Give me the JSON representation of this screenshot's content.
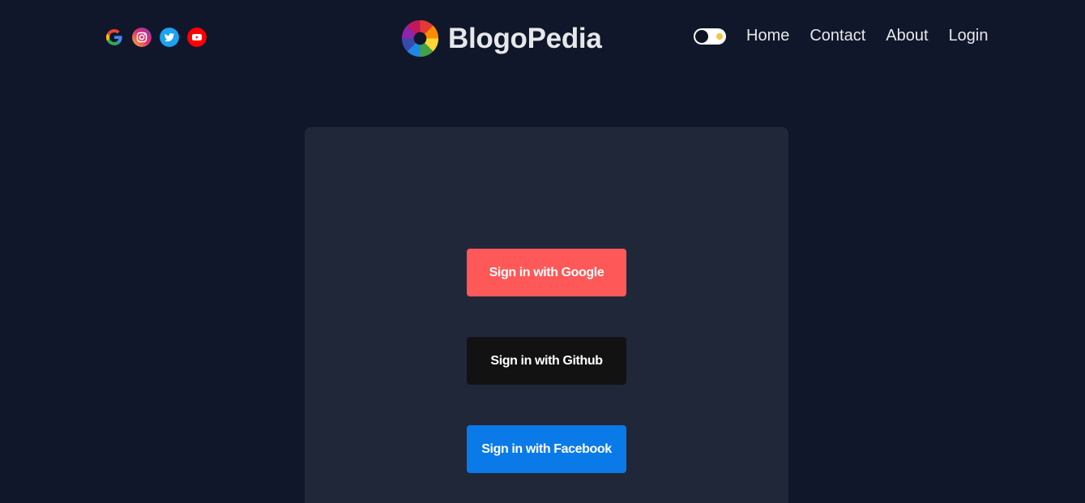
{
  "header": {
    "social": [
      {
        "icon": "google-icon",
        "color": "#4285f4"
      },
      {
        "icon": "instagram-icon",
        "color": "#e1306c"
      },
      {
        "icon": "twitter-icon",
        "color": "#1da1f2"
      },
      {
        "icon": "youtube-icon",
        "color": "#ff0000"
      }
    ],
    "brand_name": "BlogoPedia",
    "theme_toggle": {
      "state": "dark"
    },
    "nav": {
      "home": "Home",
      "contact": "Contact",
      "about": "About",
      "login": "Login"
    }
  },
  "auth": {
    "google": {
      "label": "Sign in with Google",
      "color": "#fe5858"
    },
    "github": {
      "label": "Sign in with Github",
      "color": "#121212"
    },
    "facebook": {
      "label": "Sign in with Facebook",
      "color": "#0a7ae9"
    }
  },
  "colors": {
    "background": "#10172a",
    "card": "#202739",
    "text": "#e6e7ea"
  }
}
